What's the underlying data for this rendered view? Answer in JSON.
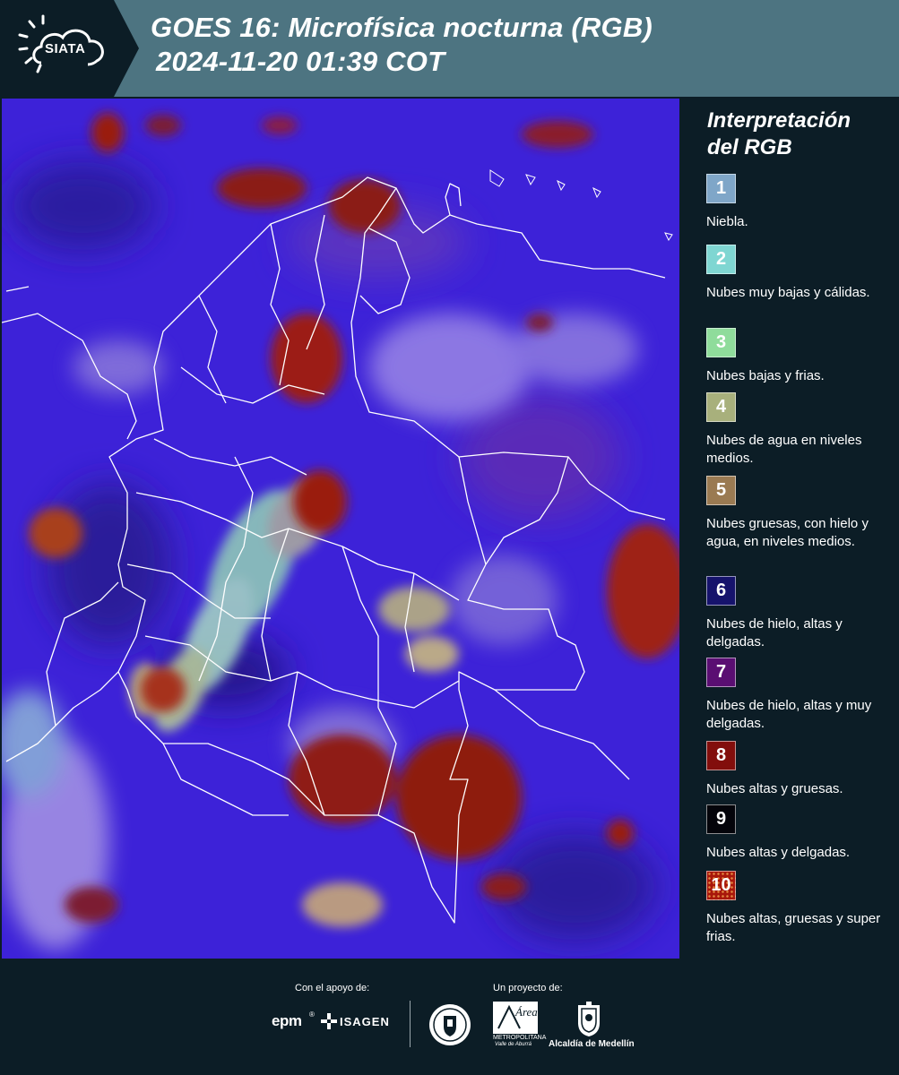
{
  "header": {
    "logo_text": "SIATA",
    "title_line1": "GOES 16: Microfísica nocturna (RGB)",
    "title_line2": "2024-11-20 01:39 COT"
  },
  "legend": {
    "title_line1": "Interpretación",
    "title_line2": "del RGB",
    "items": [
      {
        "num": "1",
        "color": "#7fa6c8",
        "label": "Niebla."
      },
      {
        "num": "2",
        "color": "#7fd6d2",
        "label": "Nubes muy bajas y cálidas."
      },
      {
        "num": "3",
        "color": "#8fdc9b",
        "label": "Nubes bajas y frias."
      },
      {
        "num": "4",
        "color": "#a8b07c",
        "label": "Nubes de agua en niveles medios."
      },
      {
        "num": "5",
        "color": "#9a7a52",
        "label": "Nubes gruesas, con hielo y agua, en niveles medios."
      },
      {
        "num": "6",
        "color": "#16136c",
        "label": "Nubes de hielo, altas y delgadas."
      },
      {
        "num": "7",
        "color": "#5a0e72",
        "label": "Nubes de hielo, altas y muy delgadas."
      },
      {
        "num": "8",
        "color": "#820e0c",
        "label": "Nubes altas y gruesas."
      },
      {
        "num": "9",
        "color": "#04040a",
        "label": "Nubes altas y delgadas."
      },
      {
        "num": "10",
        "color": "#a8170b",
        "label": "Nubes altas, gruesas y super frias."
      }
    ]
  },
  "footer": {
    "support_caption": "Con el apoyo de:",
    "project_caption": "Un proyecto de:",
    "epm_logo": "epm",
    "isagen_logo": "ISAGEN",
    "area_logo_main": "Área",
    "area_logo_sub1": "METROPOLITANA",
    "area_logo_sub2": "Valle de Aburrá",
    "medellin_logo": "Alcaldía de Medellín"
  }
}
